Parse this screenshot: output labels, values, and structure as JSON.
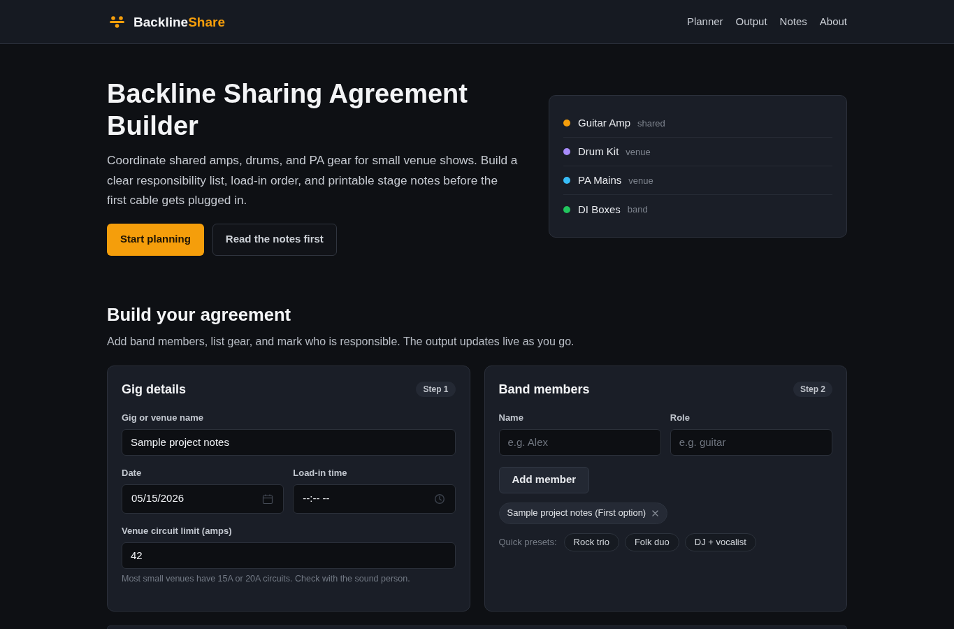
{
  "header": {
    "brand": {
      "name": "Backline",
      "accent": "Share"
    },
    "nav": [
      {
        "label": "Planner"
      },
      {
        "label": "Output"
      },
      {
        "label": "Notes"
      },
      {
        "label": "About"
      }
    ]
  },
  "hero": {
    "title": "Backline Sharing Agreement Builder",
    "description": "Coordinate shared amps, drums, and PA gear for small venue shows. Build a clear responsibility list, load-in order, and printable stage notes before the first cable gets plugged in.",
    "actions": [
      {
        "label": "Start planning",
        "kind": "primary"
      },
      {
        "label": "Read the notes first",
        "kind": "secondary"
      }
    ]
  },
  "gear_preview": [
    {
      "name": "Guitar Amp",
      "owner": "shared",
      "color": "#f59e0b"
    },
    {
      "name": "Drum Kit",
      "owner": "venue",
      "color": "#a78bfa"
    },
    {
      "name": "PA Mains",
      "owner": "venue",
      "color": "#38bdf8"
    },
    {
      "name": "DI Boxes",
      "owner": "band",
      "color": "#22c55e"
    }
  ],
  "builder": {
    "title": "Build your agreement",
    "subtitle": "Add band members, list gear, and mark who is responsible. The output updates live as you go."
  },
  "gig_details": {
    "title": "Gig details",
    "step": "Step 1",
    "fields": [
      {
        "label": "Gig or venue name",
        "kind": "text",
        "value": "Sample project notes"
      },
      {
        "label": "Date",
        "kind": "date",
        "value": "05/15/2026"
      },
      {
        "label": "Load-in time",
        "kind": "time",
        "value": "--:-- --"
      },
      {
        "label": "Venue circuit limit (amps)",
        "kind": "number",
        "value": "42",
        "hint": "Most small venues have 15A or 20A circuits. Check with the sound person."
      }
    ]
  },
  "band_members": {
    "title": "Band members",
    "step": "Step 2",
    "fields": [
      {
        "label": "Name",
        "placeholder": "e.g. Alex"
      },
      {
        "label": "Role",
        "placeholder": "e.g. guitar"
      }
    ],
    "add_button": "Add member",
    "members": [
      {
        "label": "Sample project notes (First option)"
      }
    ],
    "presets_label": "Quick presets:",
    "presets": [
      {
        "label": "Rock trio"
      },
      {
        "label": "Folk duo"
      },
      {
        "label": "DJ + vocalist"
      }
    ]
  }
}
